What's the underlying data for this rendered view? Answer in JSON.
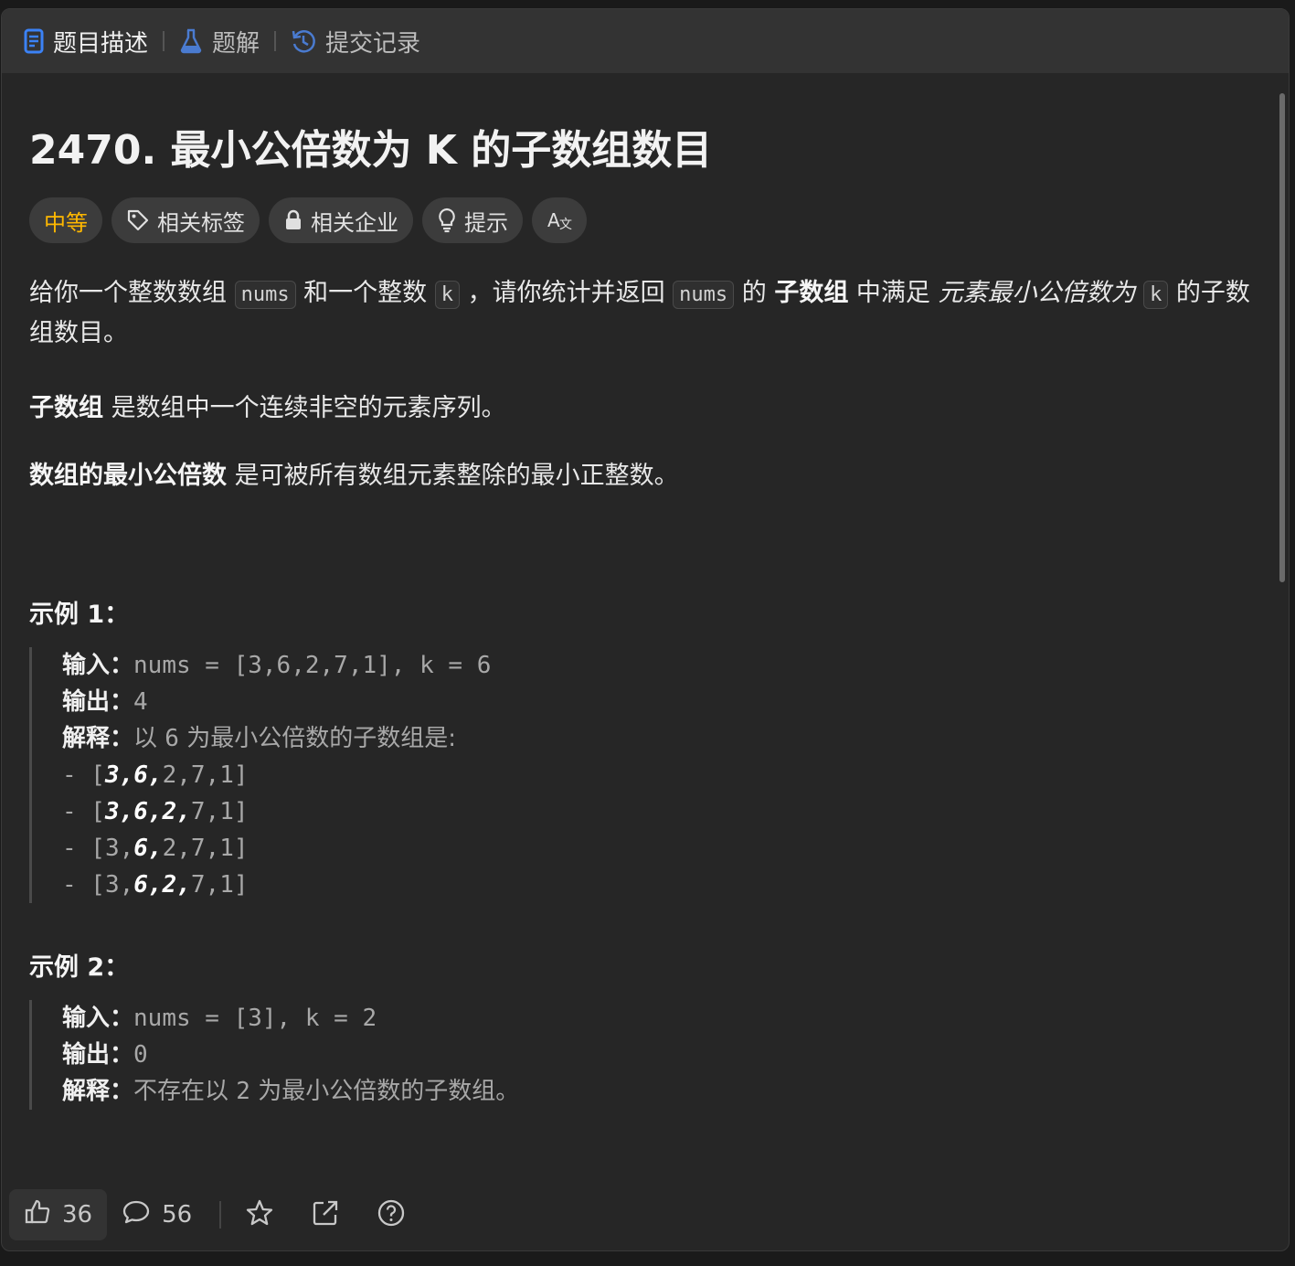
{
  "tabs": [
    {
      "label": "题目描述",
      "icon": "document-icon"
    },
    {
      "label": "题解",
      "icon": "flask-icon"
    },
    {
      "label": "提交记录",
      "icon": "history-icon"
    }
  ],
  "problem": {
    "title": "2470. 最小公倍数为 K 的子数组数目",
    "tags": {
      "difficulty": "中等",
      "topics": "相关标签",
      "companies": "相关企业",
      "hint": "提示"
    },
    "desc": {
      "p1": {
        "t1": "给你一个整数数组 ",
        "c1": "nums",
        "t2": " 和一个整数 ",
        "c2": "k",
        "t3": " ，请你统计并返回 ",
        "c3": "nums",
        "t4": " 的 ",
        "b1": "子数组",
        "t5": " 中满足 ",
        "i1": "元素最小公倍数为 ",
        "c4": "k",
        "t6": " 的子数组数目。"
      },
      "p2": {
        "b": "子数组",
        "t": " 是数组中一个连续非空的元素序列。"
      },
      "p3": {
        "b": "数组的最小公倍数",
        "t": " 是可被所有数组元素整除的最小正整数。"
      }
    },
    "examples": [
      {
        "title": "示例 1：",
        "input_label": "输入：",
        "input": "nums = [3,6,2,7,1], k = 6",
        "output_label": "输出：",
        "output": "4",
        "explain_label": "解释：",
        "explain_a": "以 ",
        "explain_num": "6",
        "explain_b": " 为最小公倍数的子数组是:",
        "lines": [
          {
            "dash": "- [",
            "a": "3,6,",
            "b": "2,7,1]"
          },
          {
            "dash": "- [",
            "a": "3,6,2,",
            "b": "7,1]"
          },
          {
            "dash": "- [3,",
            "a": "6,",
            "b": "2,7,1]"
          },
          {
            "dash": "- [3,",
            "a": "6,2,",
            "b": "7,1]"
          }
        ]
      },
      {
        "title": "示例 2：",
        "input_label": "输入：",
        "input": "nums = [3], k = 2",
        "output_label": "输出：",
        "output": "0",
        "explain_label": "解释：",
        "explain_a": "不存在以 ",
        "explain_num": "2",
        "explain_b": " 为最小公倍数的子数组。"
      }
    ]
  },
  "footer": {
    "likes": "36",
    "comments": "56"
  },
  "colors": {
    "accent": "#3b82f6",
    "difficulty": "#ffb800",
    "background": "#262626"
  }
}
